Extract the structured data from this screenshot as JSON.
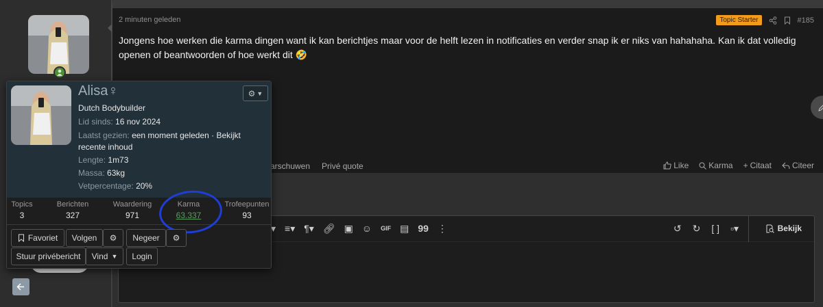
{
  "post": {
    "time": "2 minuten geleden",
    "badge": "Topic Starter",
    "number": "#185",
    "text": "Jongens hoe werken die karma dingen want ik kan berichtjes maar voor de helft lezen in notificaties en verder snap ik er niks van hahahaha. Kan ik dat volledig openen of beantwoorden of hoe werkt dit 🤣",
    "actions_left": [
      "arschuwen",
      "Privé quote"
    ],
    "actions_right": [
      {
        "icon": "thumbs-up-icon",
        "label": "Like"
      },
      {
        "icon": "search-icon",
        "label": "Karma"
      },
      {
        "icon": "plus-icon",
        "label": "Citaat"
      },
      {
        "icon": "reply-icon",
        "label": "Citeer"
      }
    ]
  },
  "editor": {
    "preview_label": "Bekijk",
    "gif_label": "GIF"
  },
  "member": {
    "name": "Alisa",
    "gender_symbol": "♀",
    "title": "Dutch Bodybuilder",
    "joined_label": "Lid sinds:",
    "joined": "16 nov 2024",
    "last_seen_label": "Laatst gezien:",
    "last_seen": "een moment geleden · Bekijkt recente inhoud",
    "length_label": "Lengte:",
    "length": "1m73",
    "mass_label": "Massa:",
    "mass": "63kg",
    "fat_label": "Vetpercentage:",
    "fat": "20%",
    "stats": [
      {
        "label": "Topics",
        "value": "3"
      },
      {
        "label": "Berichten",
        "value": "327"
      },
      {
        "label": "Waardering",
        "value": "971"
      },
      {
        "label": "Karma",
        "value": "63.337"
      },
      {
        "label": "Trofeepunten",
        "value": "93"
      }
    ],
    "buttons": {
      "favorite": "Favoriet",
      "follow": "Volgen",
      "ignore": "Negeer",
      "message": "Stuur privébericht",
      "find": "Vind",
      "login": "Login"
    }
  },
  "colors": {
    "accent_badge": "#f39c1c",
    "online": "#4f8f3a",
    "karma_link": "#5a9e5e",
    "annotation_circle": "#1f3ed8"
  }
}
